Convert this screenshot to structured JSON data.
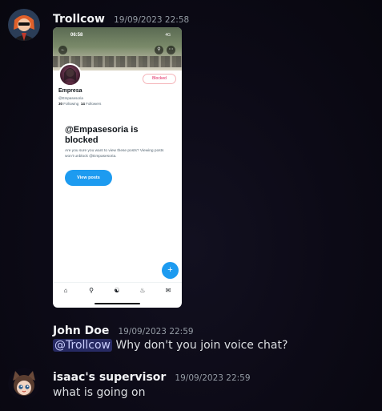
{
  "messages": [
    {
      "username": "Trollcow",
      "timestamp": "19/09/2023 22:58",
      "attachment": {
        "status_time": "06:58",
        "status_right": "4G",
        "profile_name": "Empresa",
        "handle": "@Empasesoria",
        "following_count": "30",
        "following_label": "Following",
        "followers_count": "14",
        "followers_label": "Followers",
        "blocked_label": "Blocked",
        "blocked_title": "@Empasesoria is blocked",
        "blocked_desc": "Are you sure you want to view these posts? Viewing posts won't unblock @Empasesoria.",
        "view_posts_label": "View posts"
      }
    },
    {
      "username": "John Doe",
      "timestamp": "19/09/2023 22:59",
      "mention": "@Trollcow",
      "text": " Why don't you join voice chat?"
    },
    {
      "username": "isaac's supervisor",
      "timestamp": "19/09/2023 22:59",
      "text": "what is going on"
    }
  ],
  "colors": {
    "background": "#0c0a16",
    "mention_bg": "#4b4f9e",
    "accent_blue": "#1d9bf0"
  }
}
